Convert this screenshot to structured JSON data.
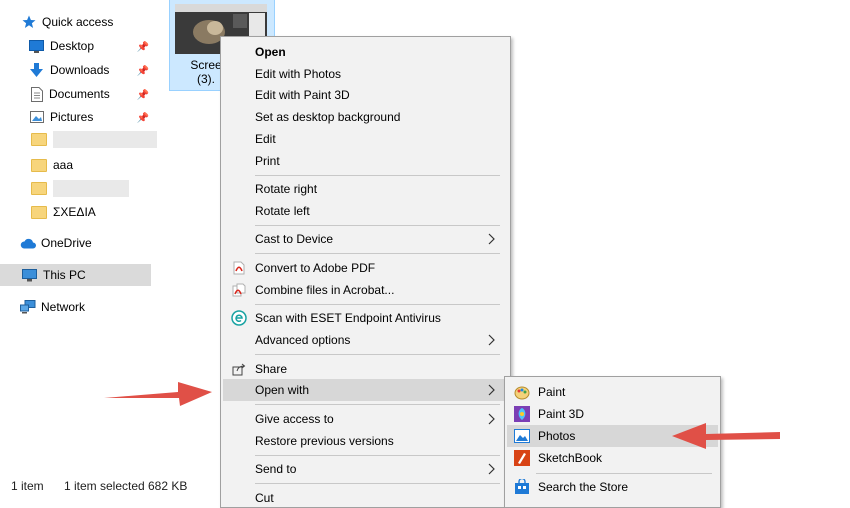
{
  "nav": {
    "quick_access": "Quick access",
    "desktop": "Desktop",
    "downloads": "Downloads",
    "documents": "Documents",
    "pictures": "Pictures",
    "folder_aaa": "aaa",
    "folder_sxedia": "ΣΧΕΔΙΑ",
    "onedrive": "OneDrive",
    "this_pc": "This PC",
    "network": "Network"
  },
  "file": {
    "name_line1": "Scree",
    "name_line2": "(3)."
  },
  "status": {
    "items": "1 item",
    "selected": "1 item selected",
    "size": "682 KB"
  },
  "context_menu": {
    "open": "Open",
    "edit_photos": "Edit with Photos",
    "edit_paint3d": "Edit with Paint 3D",
    "set_background": "Set as desktop background",
    "edit": "Edit",
    "print": "Print",
    "rotate_right": "Rotate right",
    "rotate_left": "Rotate left",
    "cast": "Cast to Device",
    "convert_pdf": "Convert to Adobe PDF",
    "combine_acrobat": "Combine files in Acrobat...",
    "scan_eset": "Scan with ESET Endpoint Antivirus",
    "advanced": "Advanced options",
    "share": "Share",
    "open_with": "Open with",
    "give_access": "Give access to",
    "restore": "Restore previous versions",
    "send_to": "Send to",
    "cut": "Cut"
  },
  "submenu": {
    "paint": "Paint",
    "paint3d": "Paint 3D",
    "photos": "Photos",
    "sketchbook": "SketchBook",
    "store": "Search the Store"
  },
  "colors": {
    "selection": "#cce8ff",
    "menu_bg": "#f2f2f2",
    "hover": "#d7d7d7",
    "annotation_arrow": "#e05047",
    "accent_blue": "#1f7ad6"
  },
  "icons": {
    "quick_access": "star-icon",
    "desktop": "desktop-icon",
    "downloads": "download-arrow-icon",
    "documents": "document-icon",
    "pictures": "pictures-icon",
    "pin": "pin-icon",
    "folder": "folder-icon",
    "onedrive": "cloud-icon",
    "this_pc": "computer-icon",
    "network": "network-icon",
    "pdf": "pdf-icon",
    "eset": "eset-icon",
    "share": "share-icon",
    "submenu_arrow": "chevron-right-icon"
  }
}
